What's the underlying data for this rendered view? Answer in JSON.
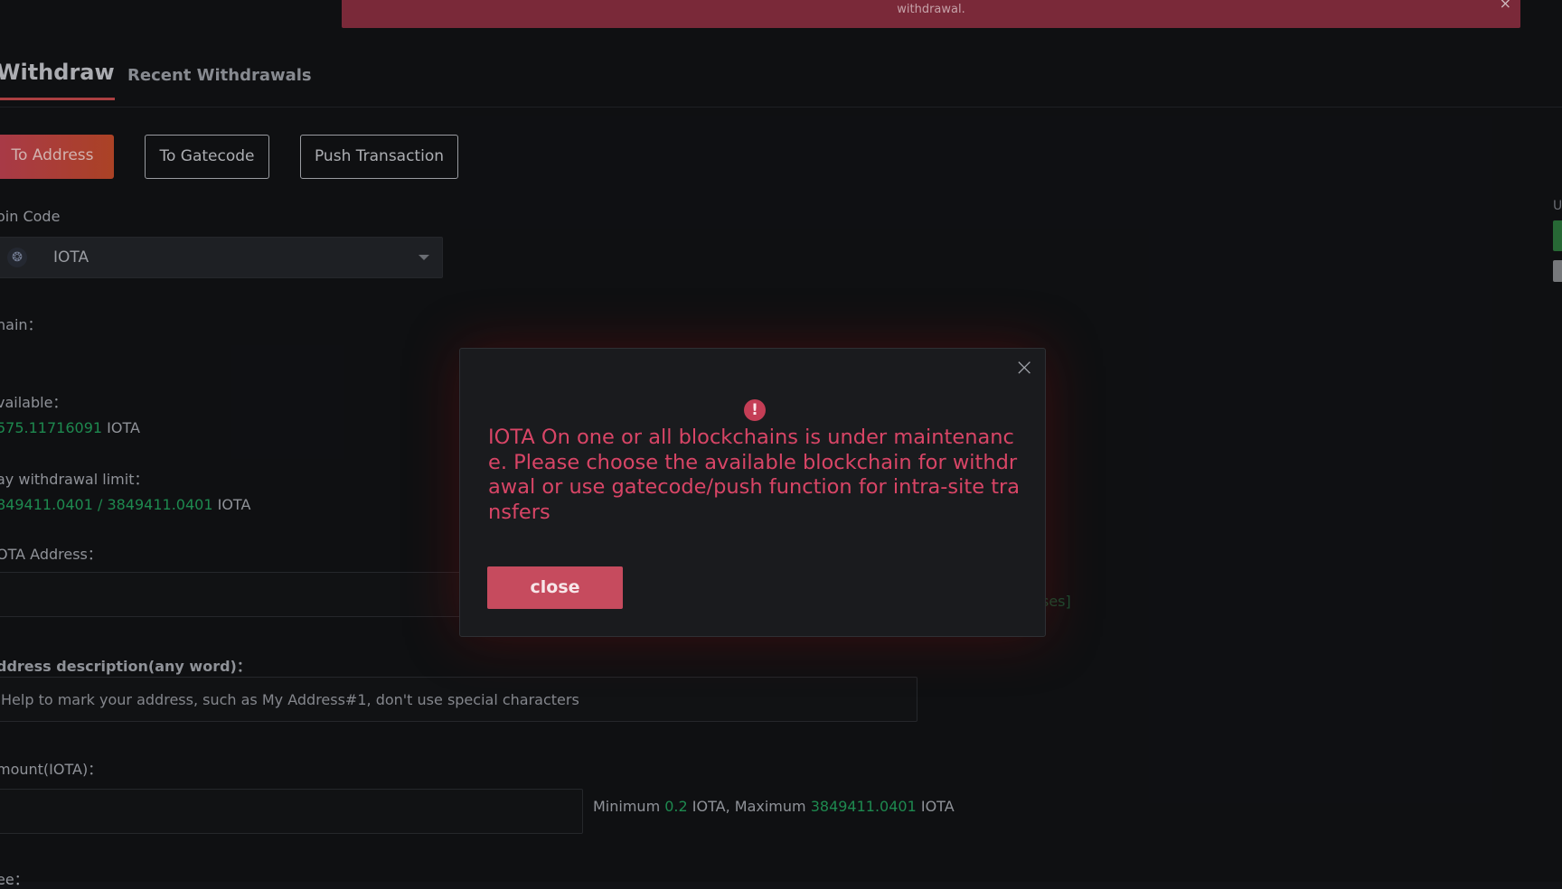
{
  "notice": {
    "text": "withdrawal.",
    "close_glyph": "×"
  },
  "tabs": {
    "withdraw": "Withdraw",
    "recent": "Recent Withdrawals"
  },
  "sub_tabs": {
    "to_address": "To Address",
    "to_gatecode": "To Gatecode",
    "push_transaction": "Push Transaction"
  },
  "form": {
    "coin_code_label": "oin Code",
    "coin_value": "IOTA",
    "coin_icon": "iota-coin-icon",
    "chain_label": "hain：",
    "available_label": "vailable：",
    "available_value": "575.11716091",
    "available_unit": "IOTA",
    "day_limit_label": "ay withdrawal limit：",
    "day_limit_value": "849411.0401 / 3849411.0401",
    "day_limit_unit": "IOTA",
    "address_label": "OTA Address：",
    "address_side_text": "ses]",
    "description_label": "ddress description(any word)：",
    "description_placeholder": "Help to mark your address, such as My Address#1, don't use special characters",
    "amount_label": "mount(IOTA)：",
    "min_label": "Minimum",
    "min_value": "0.2",
    "min_unit": "IOTA,",
    "max_label": "Maximum",
    "max_value": "3849411.0401",
    "max_unit": "IOTA",
    "fee_label": "ee："
  },
  "right_panel": {
    "label": "U"
  },
  "modal": {
    "icon": "alert-icon",
    "icon_glyph": "!",
    "message": "IOTA On one or all blockchains is under maintenance. Please choose the available blockchain for withdrawal or use gatecode/push function for intra-site transfers",
    "close_button": "close",
    "close_glyph": "×"
  },
  "colors": {
    "accent": "#c84a4c",
    "green": "#23a05c",
    "error": "#d84566",
    "button": "#c64b5e"
  }
}
